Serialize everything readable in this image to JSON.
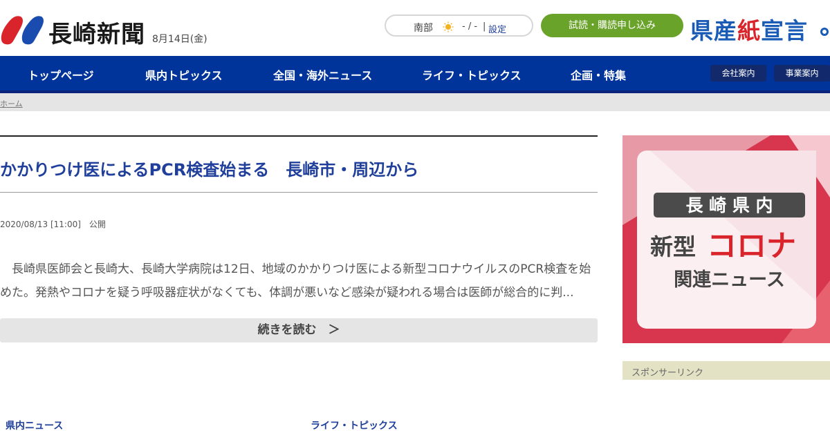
{
  "header": {
    "logo_text": "長崎新聞",
    "date": "8月14日(金)",
    "weather": {
      "region": "南部",
      "temp": "- / -",
      "separator": "|",
      "settings": "設定",
      "icon": "sun-icon"
    },
    "subscribe_label": "試読・購読申し込み",
    "pref_banner": {
      "part1": "県産",
      "part2": "紙",
      "part3": "宣言"
    }
  },
  "nav": {
    "items": [
      "トップページ",
      "県内トピックス",
      "全国・海外ニュース",
      "ライフ・トピックス",
      "企画・特集"
    ],
    "buttons": [
      "会社案内",
      "事業案内"
    ]
  },
  "breadcrumb": {
    "home": "ホーム"
  },
  "article": {
    "title": "かかりつけ医によるPCR検査始まる　長崎市・周辺から",
    "meta": "2020/08/13 [11:00]　公開",
    "body_line1": "　長崎県医師会と長崎大、長崎大学病院は12日、地域のかかりつけ医による新型コロナウイルスのPCR検査を始",
    "body_line2": "めた。発熱やコロナを疑う呼吸器症状がなくても、体調が悪いなど感染が疑われる場合は医師が総合的に判...",
    "read_more": "続きを読む　＞"
  },
  "sections": {
    "left": "県内ニュース",
    "right": "ライフ・トピックス"
  },
  "sidebar": {
    "banner": {
      "line1": "長 崎 県 内",
      "line2a": "新型",
      "line2b": "コロナ",
      "line3": "関連ニュース"
    },
    "sponsor_label": "スポンサーリンク"
  },
  "colors": {
    "nav": "#00349a",
    "link": "#1f3f9a",
    "subscribe": "#6aa329",
    "accent_red": "#d8242a"
  }
}
